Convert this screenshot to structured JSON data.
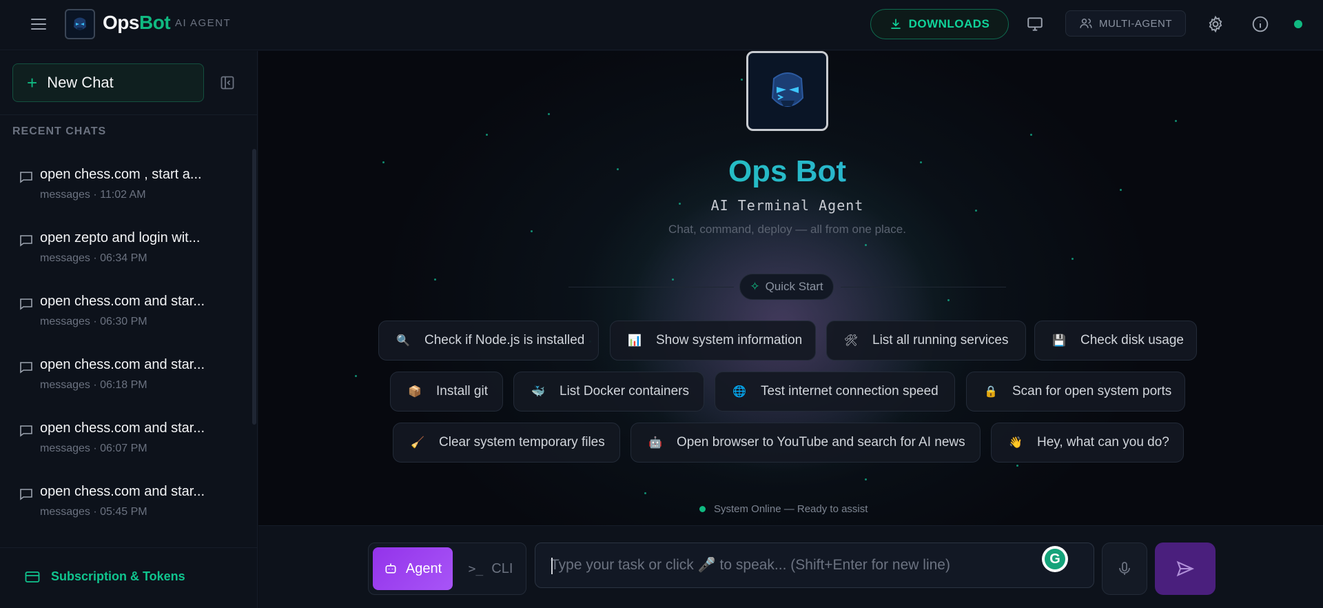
{
  "header": {
    "brand_part1": "Ops",
    "brand_part2": "Bot",
    "brand_tag": "AI AGENT",
    "downloads_label": "DOWNLOADS",
    "multi_agent_label": "MULTI-AGENT"
  },
  "sidebar": {
    "new_chat_label": "New Chat",
    "recent_title": "RECENT CHATS",
    "chats": [
      {
        "title": "open chess.com , start a...",
        "meta": "messages · 11:02 AM"
      },
      {
        "title": "open zepto and login wit...",
        "meta": "messages · 06:34 PM"
      },
      {
        "title": "open chess.com and star...",
        "meta": "messages · 06:30 PM"
      },
      {
        "title": "open chess.com and star...",
        "meta": "messages · 06:18 PM"
      },
      {
        "title": "open chess.com and star...",
        "meta": "messages · 06:07 PM"
      },
      {
        "title": "open chess.com and star...",
        "meta": "messages · 05:45 PM"
      }
    ],
    "subscription_label": "Subscription & Tokens"
  },
  "hero": {
    "title": "Ops Bot",
    "subtitle": "AI Terminal Agent",
    "description": "Chat, command, deploy — all from one place.",
    "quick_start_label": "Quick Start"
  },
  "quick_actions": [
    {
      "icon": "🔍",
      "label": "Check if Node.js is installed"
    },
    {
      "icon": "📊",
      "label": "Show system information"
    },
    {
      "icon": "🛠",
      "label": "List all running services"
    },
    {
      "icon": "💾",
      "label": "Check disk usage"
    },
    {
      "icon": "📦",
      "label": "Install git"
    },
    {
      "icon": "🐳",
      "label": "List Docker containers"
    },
    {
      "icon": "🌐",
      "label": "Test internet connection speed"
    },
    {
      "icon": "🔒",
      "label": "Scan for open system ports"
    },
    {
      "icon": "🧹",
      "label": "Clear system temporary files"
    },
    {
      "icon": "🤖",
      "label": "Open browser to YouTube and search for AI news"
    },
    {
      "icon": "👋",
      "label": "Hey, what can you do?"
    }
  ],
  "status": {
    "online_text": "System Online — Ready to assist"
  },
  "composer": {
    "mode_agent": "Agent",
    "mode_cli": "CLI",
    "placeholder": "Type your task or click 🎤 to speak... (Shift+Enter for new line)",
    "value": ""
  },
  "colors": {
    "accent": "#10b981",
    "brand_purple": "#9333ea"
  }
}
